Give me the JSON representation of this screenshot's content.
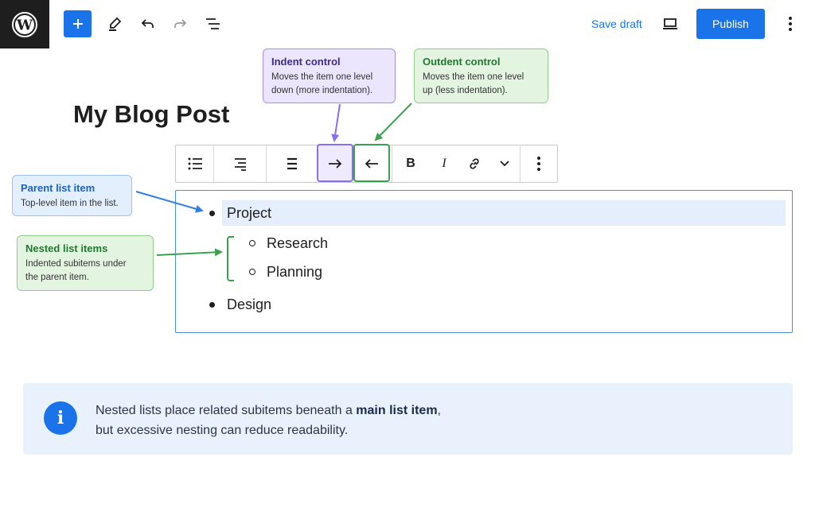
{
  "topbar": {
    "logo": "wordpress-logo",
    "add_icon": "plus-icon",
    "tools_icon": "pencil-icon",
    "undo_icon": "undo-icon",
    "redo_icon": "redo-icon",
    "outline_icon": "list-view-icon",
    "save_draft": "Save draft",
    "preview_icon": "laptop-icon",
    "publish": "Publish",
    "options_icon": "more-vertical-icon"
  },
  "post": {
    "title": "My Blog Post"
  },
  "block_toolbar": {
    "buttons": [
      "list-icon",
      "align-icon",
      "justify-icon",
      "indent-icon",
      "outdent-icon",
      "bold-icon",
      "italic-icon",
      "link-icon",
      "chevron-down-icon",
      "more-vertical-icon"
    ],
    "bold": "B",
    "italic": "I"
  },
  "list": {
    "items": [
      {
        "text": "Project",
        "level": 1
      },
      {
        "text": "Research",
        "level": 2
      },
      {
        "text": "Planning",
        "level": 2
      },
      {
        "text": "Design",
        "level": 1
      }
    ]
  },
  "callouts": {
    "indent": {
      "title": "Indent control",
      "desc1": "Moves the item one level",
      "desc2": "down (more indentation)."
    },
    "outdent": {
      "title": "Outdent control",
      "desc1": "Moves the item one level",
      "desc2": "up (less indentation)."
    },
    "parent": {
      "title": "Parent list item",
      "desc1": "Top-level item in the list."
    },
    "nested": {
      "title": "Nested list items",
      "desc1": "Indented subitems under",
      "desc2": "the parent item."
    }
  },
  "info": {
    "icon": "info-icon",
    "line1_pre": "Nested lists place related subitems beneath a ",
    "line1_bold": "main list item",
    "line1_post": ",",
    "line2": "but excessive nesting can reduce readability."
  },
  "colors": {
    "accent": "#1a73e8",
    "indent": "#8b6df0",
    "outdent": "#3aa14f",
    "dark": "#1e1e1e"
  }
}
